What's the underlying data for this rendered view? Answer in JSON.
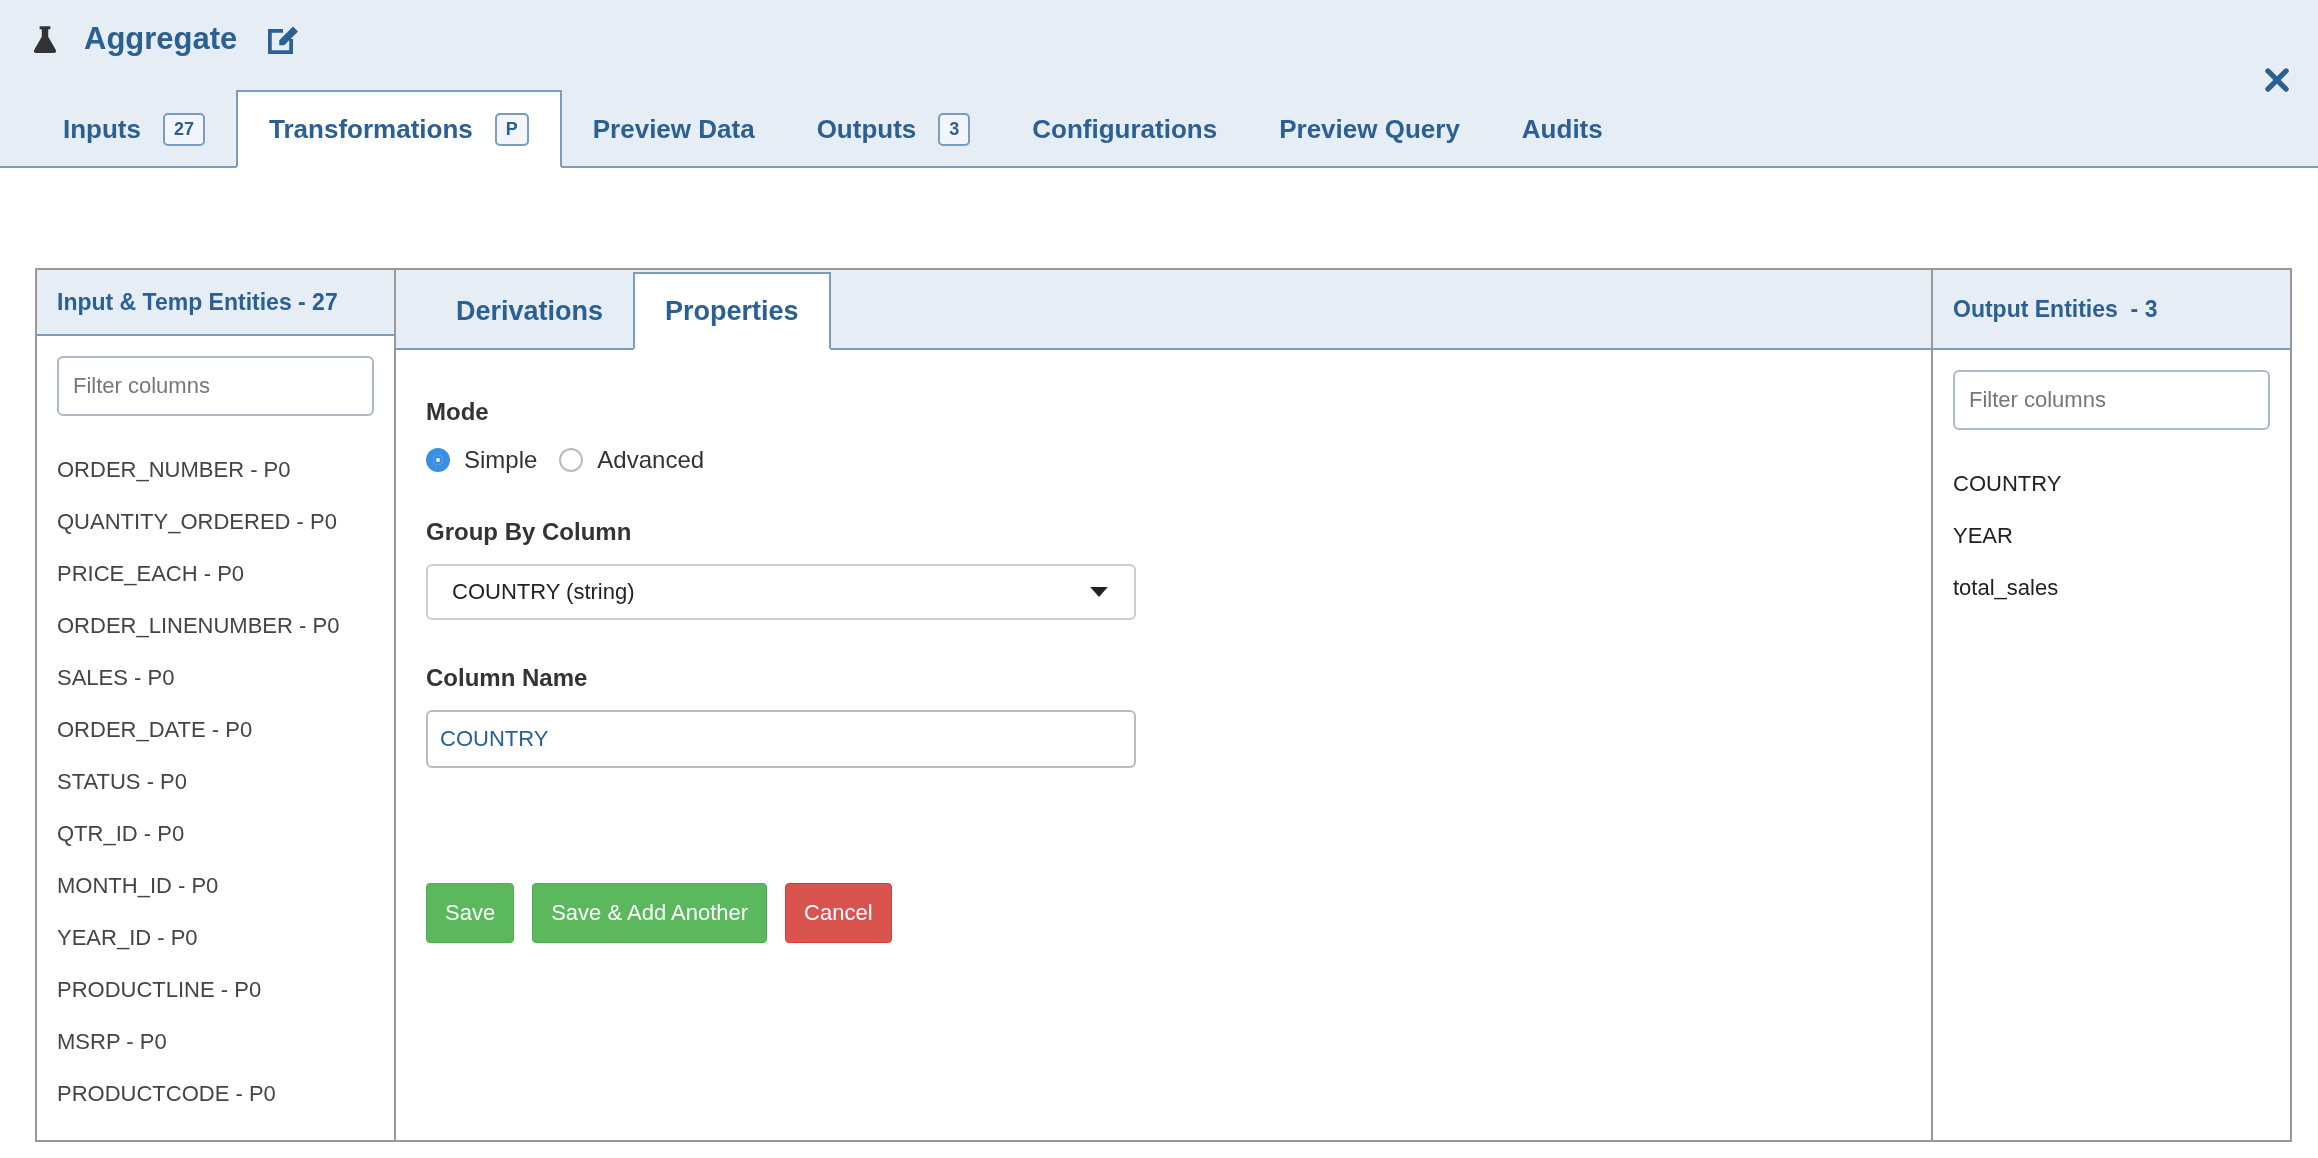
{
  "header": {
    "title": "Aggregate"
  },
  "tabs": [
    {
      "label": "Inputs",
      "badge": "27",
      "selected": false
    },
    {
      "label": "Transformations",
      "badge": "P",
      "selected": true
    },
    {
      "label": "Preview Data",
      "selected": false
    },
    {
      "label": "Outputs",
      "badge": "3",
      "selected": false
    },
    {
      "label": "Configurations",
      "selected": false
    },
    {
      "label": "Preview Query",
      "selected": false
    },
    {
      "label": "Audits",
      "selected": false
    }
  ],
  "left_panel": {
    "title": "Input & Temp Entities - 27",
    "filter": {
      "placeholder": "Filter columns"
    },
    "items": [
      "ORDER_NUMBER - P0",
      "QUANTITY_ORDERED - P0",
      "PRICE_EACH - P0",
      "ORDER_LINENUMBER - P0",
      "SALES - P0",
      "ORDER_DATE - P0",
      "STATUS - P0",
      "QTR_ID - P0",
      "MONTH_ID - P0",
      "YEAR_ID - P0",
      "PRODUCTLINE - P0",
      "MSRP - P0",
      "PRODUCTCODE - P0"
    ]
  },
  "sub_tabs": [
    {
      "label": "Derivations",
      "selected": false
    },
    {
      "label": "Properties",
      "selected": true
    }
  ],
  "form": {
    "mode_label": "Mode",
    "modes": [
      {
        "label": "Simple",
        "selected": true
      },
      {
        "label": "Advanced",
        "selected": false
      }
    ],
    "group_label": "Group By Column",
    "group_value": "COUNTRY (string)",
    "name_label": "Column Name",
    "name_value": "COUNTRY",
    "buttons": [
      {
        "label": "Save",
        "kind": "success"
      },
      {
        "label": "Save & Add Another",
        "kind": "success"
      },
      {
        "label": "Cancel",
        "kind": "danger"
      }
    ]
  },
  "right_panel": {
    "title": "Output Entities  - 3",
    "filter": {
      "placeholder": "Filter columns"
    },
    "items": [
      "COUNTRY",
      "YEAR",
      "total_sales"
    ]
  }
}
